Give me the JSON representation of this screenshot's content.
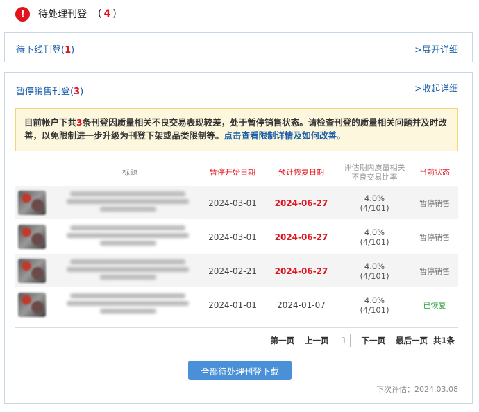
{
  "header": {
    "title": "待处理刊登",
    "count_open": "(",
    "count": "4",
    "count_close": ")"
  },
  "offline_panel": {
    "title": "待下线刊登",
    "count_open": "(",
    "count": "1",
    "count_close": ")",
    "toggle_label": ">展开详细"
  },
  "paused_panel": {
    "title": "暂停销售刊登",
    "count_open": "(",
    "count": "3",
    "count_close": ")",
    "toggle_label": ">收起详细",
    "notice": {
      "part1": "目前帐户下共",
      "num": "3",
      "part2": "条刊登因质量相关不良交易表现较差，处于暂停销售状态。请检查刊登的质量相关问题并及时改善，以免限制进一步升级为刊登下架或品类限制等。",
      "link": "点击查看限制详情及如何改善。"
    },
    "columns": {
      "title": "标题",
      "start": "暂停开始日期",
      "end": "预计恢复日期",
      "rate": "评估期内质量相关不良交易比率",
      "status": "当前状态"
    },
    "rows": [
      {
        "start": "2024-03-01",
        "end": "2024-06-27",
        "rate": "4.0%",
        "rate_detail": "(4/101)",
        "status": "暂停销售"
      },
      {
        "start": "2024-03-01",
        "end": "2024-06-27",
        "rate": "4.0%",
        "rate_detail": "(4/101)",
        "status": "暂停销售"
      },
      {
        "start": "2024-02-21",
        "end": "2024-06-27",
        "rate": "4.0%",
        "rate_detail": "(4/101)",
        "status": "暂停销售"
      },
      {
        "start": "2024-01-01",
        "end": "2024-01-07",
        "rate": "4.0%",
        "rate_detail": "(4/101)",
        "status": "已恢复"
      }
    ],
    "pager": {
      "first": "第一页",
      "prev": "上一页",
      "current": "1",
      "next": "下一页",
      "last": "最后一页",
      "total": "共1条"
    },
    "download_label": "全部待处理刊登下载",
    "next_eval": "下次评估：2024.03.08"
  },
  "colors": {
    "accent_red": "#e0141e",
    "link_blue": "#1a5ea8",
    "button_blue": "#4a90d9",
    "recovered_green": "#2a9d3c"
  }
}
